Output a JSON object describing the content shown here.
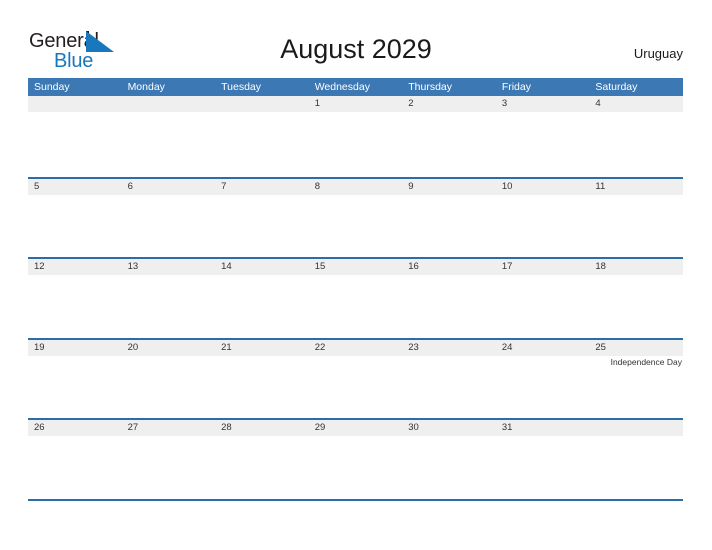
{
  "brand": {
    "name_part1": "General",
    "name_part2": "Blue",
    "logo_icon": "triangle-flag-icon",
    "accent_color": "#1878be"
  },
  "header": {
    "title": "August 2029",
    "country": "Uruguay"
  },
  "theme": {
    "header_blue": "#3b78b4",
    "rule_blue": "#2d6ca8",
    "band_gray": "#efefef",
    "text_dark": "#333333"
  },
  "calendar": {
    "weekdays": [
      "Sunday",
      "Monday",
      "Tuesday",
      "Wednesday",
      "Thursday",
      "Friday",
      "Saturday"
    ],
    "weeks": [
      [
        {
          "day": "",
          "events": []
        },
        {
          "day": "",
          "events": []
        },
        {
          "day": "",
          "events": []
        },
        {
          "day": "1",
          "events": []
        },
        {
          "day": "2",
          "events": []
        },
        {
          "day": "3",
          "events": []
        },
        {
          "day": "4",
          "events": []
        }
      ],
      [
        {
          "day": "5",
          "events": []
        },
        {
          "day": "6",
          "events": []
        },
        {
          "day": "7",
          "events": []
        },
        {
          "day": "8",
          "events": []
        },
        {
          "day": "9",
          "events": []
        },
        {
          "day": "10",
          "events": []
        },
        {
          "day": "11",
          "events": []
        }
      ],
      [
        {
          "day": "12",
          "events": []
        },
        {
          "day": "13",
          "events": []
        },
        {
          "day": "14",
          "events": []
        },
        {
          "day": "15",
          "events": []
        },
        {
          "day": "16",
          "events": []
        },
        {
          "day": "17",
          "events": []
        },
        {
          "day": "18",
          "events": []
        }
      ],
      [
        {
          "day": "19",
          "events": []
        },
        {
          "day": "20",
          "events": []
        },
        {
          "day": "21",
          "events": []
        },
        {
          "day": "22",
          "events": []
        },
        {
          "day": "23",
          "events": []
        },
        {
          "day": "24",
          "events": []
        },
        {
          "day": "25",
          "events": [
            "Independence Day"
          ]
        }
      ],
      [
        {
          "day": "26",
          "events": []
        },
        {
          "day": "27",
          "events": []
        },
        {
          "day": "28",
          "events": []
        },
        {
          "day": "29",
          "events": []
        },
        {
          "day": "30",
          "events": []
        },
        {
          "day": "31",
          "events": []
        },
        {
          "day": "",
          "events": []
        }
      ]
    ]
  }
}
